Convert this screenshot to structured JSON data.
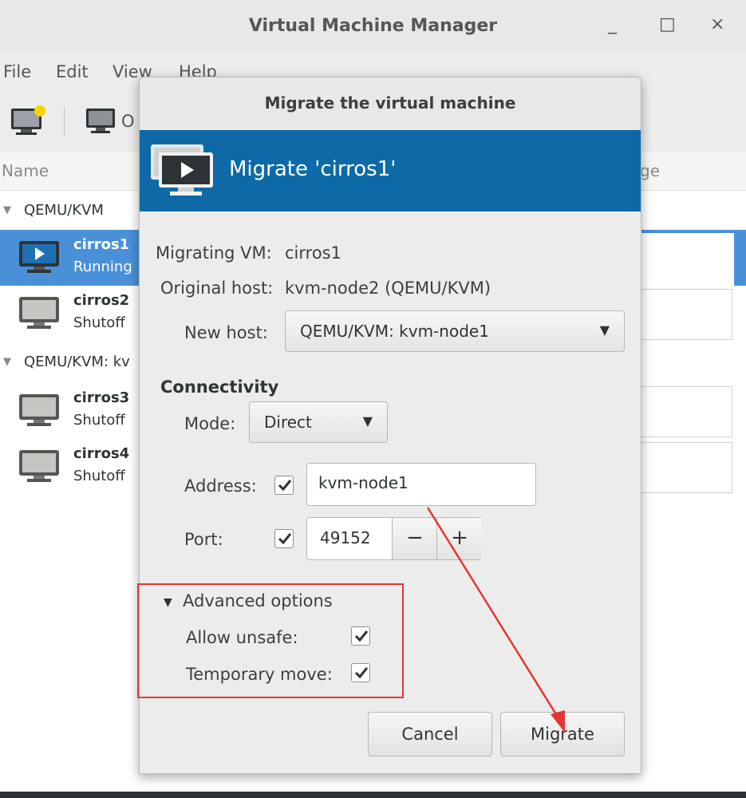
{
  "main_window": {
    "title": "Virtual Machine Manager",
    "controls": {
      "minimize": "_",
      "maximize": "□",
      "close": "×"
    },
    "menu": [
      "File",
      "Edit",
      "View",
      "Help"
    ],
    "toolbar": {
      "open_label": "O"
    },
    "columns": {
      "name": "Name",
      "cpu_usage": "ge"
    },
    "groups": [
      {
        "label": "QEMU/KVM",
        "vms": [
          {
            "name": "cirros1",
            "status": "Running",
            "selected": true
          },
          {
            "name": "cirros2",
            "status": "Shutoff"
          }
        ]
      },
      {
        "label": "QEMU/KVM: kv",
        "vms": [
          {
            "name": "cirros3",
            "status": "Shutoff"
          },
          {
            "name": "cirros4",
            "status": "Shutoff"
          }
        ]
      }
    ]
  },
  "dialog": {
    "title": "Migrate the virtual machine",
    "banner": "Migrate 'cirros1'",
    "migrating_vm_label": "Migrating VM:",
    "migrating_vm_value": "cirros1",
    "original_host_label": "Original host:",
    "original_host_value": "kvm-node2 (QEMU/KVM)",
    "new_host_label": "New host:",
    "new_host_value": "QEMU/KVM: kvm-node1",
    "connectivity_heading": "Connectivity",
    "mode_label": "Mode:",
    "mode_value": "Direct",
    "address_label": "Address:",
    "address_checked": true,
    "address_value": "kvm-node1",
    "port_label": "Port:",
    "port_checked": true,
    "port_value": "49152",
    "port_decrement": "−",
    "port_increment": "+",
    "advanced_heading": "Advanced options",
    "allow_unsafe_label": "Allow unsafe:",
    "allow_unsafe_checked": true,
    "temporary_move_label": "Temporary move:",
    "temporary_move_checked": true,
    "cancel_label": "Cancel",
    "migrate_label": "Migrate"
  },
  "colors": {
    "banner": "#0d6aa6",
    "selection": "#4a90d9",
    "annotation": "#e53535"
  }
}
